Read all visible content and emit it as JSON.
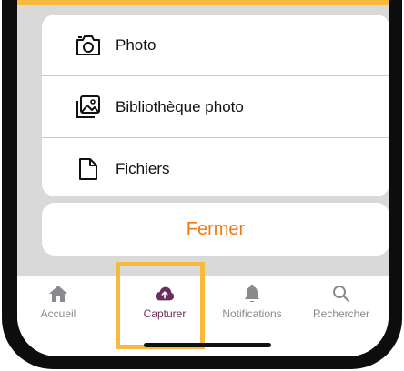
{
  "sheet": {
    "items": [
      {
        "label": "Photo",
        "icon": "camera-icon"
      },
      {
        "label": "Bibliothèque photo",
        "icon": "photo-library-icon"
      },
      {
        "label": "Fichiers",
        "icon": "file-icon"
      }
    ],
    "close_label": "Fermer"
  },
  "tabbar": {
    "tabs": [
      {
        "label": "Accueil",
        "icon": "home-icon",
        "active": false
      },
      {
        "label": "Capturer",
        "icon": "cloud-upload-icon",
        "active": true
      },
      {
        "label": "Notifications",
        "icon": "bell-icon",
        "active": false
      },
      {
        "label": "Rechercher",
        "icon": "search-icon",
        "active": false
      }
    ]
  },
  "colors": {
    "accent_highlight": "#f6ba3c",
    "close_text": "#f07a12",
    "active_tab": "#6b2d5c",
    "inactive_tab": "#8a8a8e",
    "overlay": "#d9d9d9"
  }
}
